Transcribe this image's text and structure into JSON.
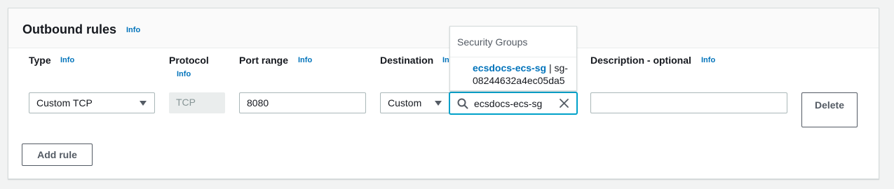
{
  "section": {
    "title": "Outbound rules",
    "info_label": "Info"
  },
  "columns": {
    "type": {
      "label": "Type",
      "info": "Info"
    },
    "protocol": {
      "label": "Protocol",
      "info": "Info"
    },
    "port_range": {
      "label": "Port range",
      "info": "Info"
    },
    "destination": {
      "label": "Destination",
      "info": "Info"
    },
    "description": {
      "label": "Description - optional",
      "info": "Info"
    }
  },
  "rule": {
    "type_value": "Custom TCP",
    "protocol_value": "TCP",
    "port_range_value": "8080",
    "destination_value": "Custom",
    "destination_search_value": "ecsdocs-ecs-sg",
    "description_value": "",
    "delete_label": "Delete"
  },
  "dropdown": {
    "group_label": "Security Groups",
    "option_name": "ecsdocs-ecs-sg",
    "option_separator": " | ",
    "option_id": "sg-08244632a4ec05da5"
  },
  "actions": {
    "add_rule_label": "Add rule"
  },
  "icons": {
    "type_caret": "caret-down-icon",
    "destination_caret": "caret-down-icon",
    "search": "search-icon",
    "clear": "close-icon"
  },
  "colors": {
    "link": "#0073bb",
    "focus": "#00a1c9",
    "text": "#16191f",
    "muted": "#879596"
  }
}
